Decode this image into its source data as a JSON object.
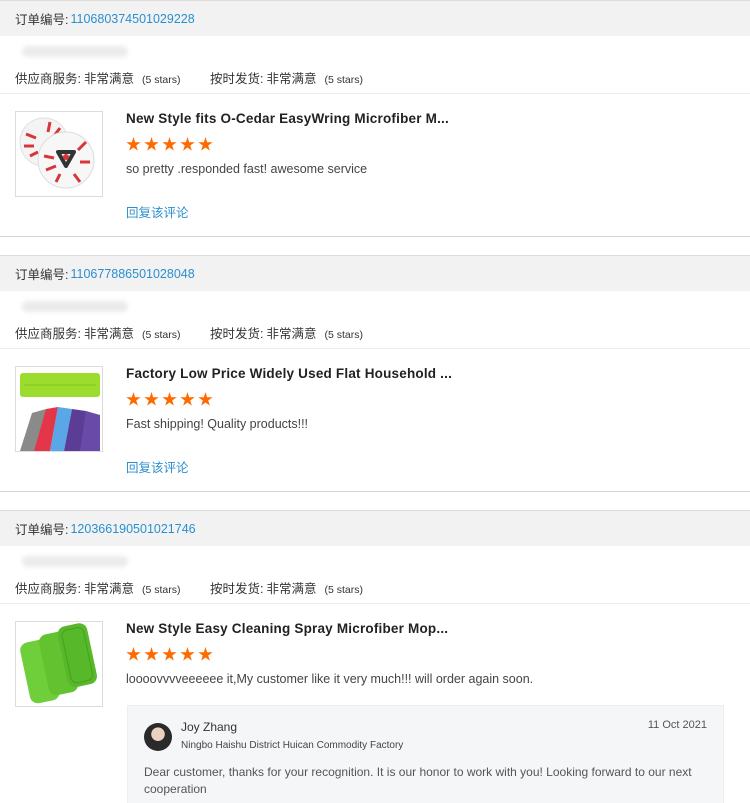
{
  "labels": {
    "order_no": "订单编号:",
    "supplier_service": "供应商服务:",
    "on_time": "按时发货:",
    "reply_link": "回复该评论"
  },
  "orders": [
    {
      "order_number": "110680374501029228",
      "supplier_rating": "非常满意",
      "supplier_stars_note": "(5 stars)",
      "shipping_rating": "非常满意",
      "shipping_stars_note": "(5 stars)",
      "product_title": "New Style fits O-Cedar EasyWring Microfiber M...",
      "rating": 5,
      "comment": "so pretty .responded fast! awesome service",
      "thumbnail_icon": "round-mop-pads-icon"
    },
    {
      "order_number": "110677886501028048",
      "supplier_rating": "非常满意",
      "supplier_stars_note": "(5 stars)",
      "shipping_rating": "非常满意",
      "shipping_stars_note": "(5 stars)",
      "product_title": "Factory Low Price Widely Used Flat Household ...",
      "rating": 5,
      "comment": "Fast shipping! Quality products!!!",
      "thumbnail_icon": "flat-mop-pads-icon"
    },
    {
      "order_number": "120366190501021746",
      "supplier_rating": "非常满意",
      "supplier_stars_note": "(5 stars)",
      "shipping_rating": "非常满意",
      "shipping_stars_note": "(5 stars)",
      "product_title": "New Style Easy Cleaning Spray Microfiber Mop...",
      "rating": 5,
      "comment": "loooovvvveeeeee it,My customer like it very much!!!  will order again soon.",
      "thumbnail_icon": "green-spray-mop-pads-icon"
    }
  ],
  "seller_reply": {
    "name": "Joy Zhang",
    "company": "Ningbo Haishu District Huican Commodity Factory",
    "date": "11 Oct 2021",
    "text": "Dear customer, thanks for your recognition. It is our honor to work with you! Looking forward to our next cooperation"
  },
  "colors": {
    "star": "#ff6a00",
    "link": "#2a8fd0",
    "header_bg": "#f2f2f2"
  }
}
